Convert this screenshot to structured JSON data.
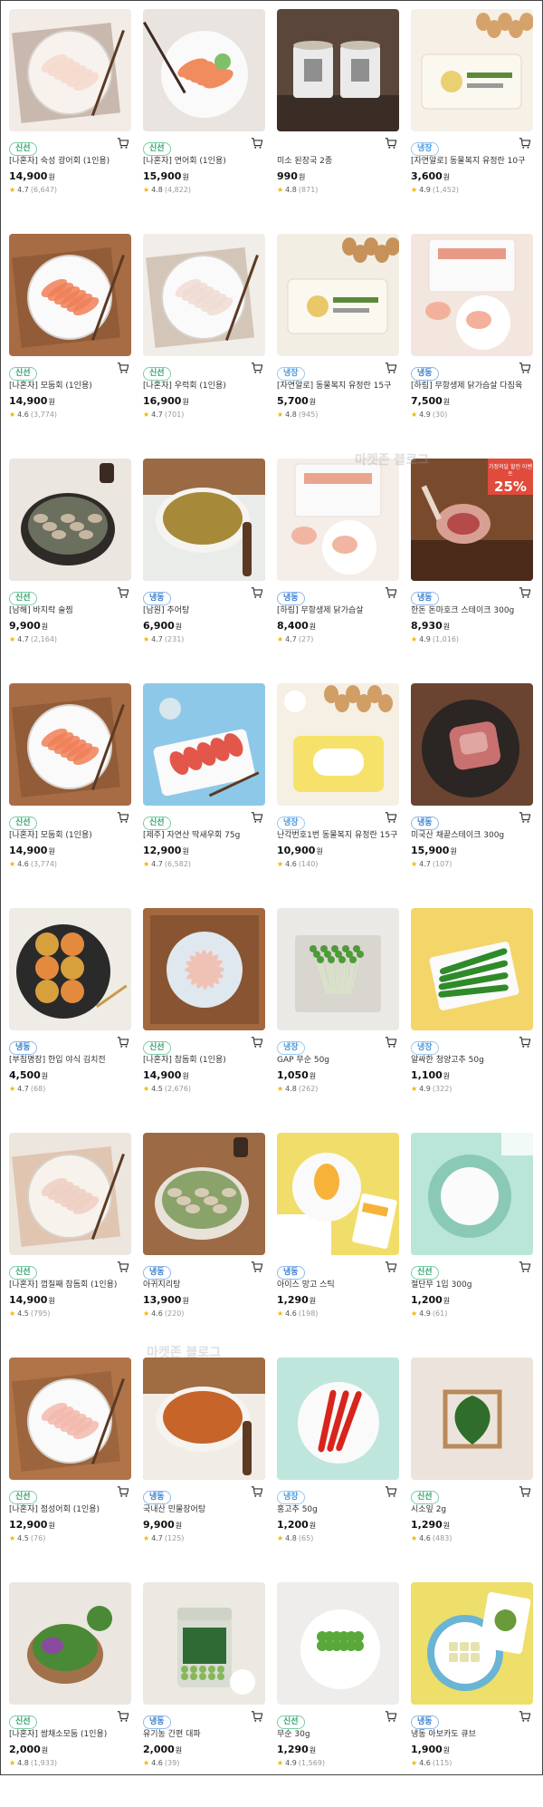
{
  "watermark": "마켓존 블로그",
  "products": [
    {
      "badge": "신선",
      "badge_type": "fresh",
      "name": "[나혼자] 숙성 광어회 (1인용)",
      "price": "14,900",
      "unit": "원",
      "score": "4.7",
      "count": "(6,647)",
      "img": "fish-plate",
      "colors": [
        "#f3ece6",
        "#7a5a44",
        "#f7f2ee",
        "#f5d9cc"
      ]
    },
    {
      "badge": "신선",
      "badge_type": "fresh",
      "name": "[나혼자] 연어회 (1인용)",
      "price": "15,900",
      "unit": "원",
      "score": "4.8",
      "count": "(4,822)",
      "img": "salmon-plate",
      "colors": [
        "#e9e4df",
        "#c89078",
        "#fafafa",
        "#f08c5e"
      ]
    },
    {
      "badge": "",
      "badge_type": "",
      "name": "미소 된장국 2종",
      "price": "990",
      "unit": "원",
      "score": "4.8",
      "count": "(871)",
      "img": "cups",
      "colors": [
        "#5a463a",
        "#3a2d26",
        "#eaeaea",
        "#c8c0b0"
      ]
    },
    {
      "badge": "냉장",
      "badge_type": "cold",
      "name": "[자연알로] 동물복지 유정란 10구",
      "price": "3,600",
      "unit": "원",
      "score": "4.9",
      "count": "(1,452)",
      "img": "eggs-box",
      "colors": [
        "#f6f0e6",
        "#d6a26b",
        "#fbf8f0",
        "#e9d070"
      ]
    },
    {
      "badge": "신선",
      "badge_type": "fresh",
      "name": "[나혼자] 모둠회 (1인용)",
      "price": "14,900",
      "unit": "원",
      "score": "4.6",
      "count": "(3,774)",
      "img": "fish-plate",
      "colors": [
        "#a86c44",
        "#6b3e24",
        "#fafafa",
        "#f07f57"
      ]
    },
    {
      "badge": "신선",
      "badge_type": "fresh",
      "name": "[나혼자] 우럭회 (1인용)",
      "price": "16,900",
      "unit": "원",
      "score": "4.7",
      "count": "(701)",
      "img": "fish-plate",
      "colors": [
        "#f1ede8",
        "#9b7b5d",
        "#fafafa",
        "#efdcd4"
      ]
    },
    {
      "badge": "냉장",
      "badge_type": "cold",
      "name": "[자연알로] 동물복지 유정란 15구",
      "price": "5,700",
      "unit": "원",
      "score": "4.8",
      "count": "(945)",
      "img": "eggs-box",
      "colors": [
        "#f3eee4",
        "#c6925a",
        "#fbf8f0",
        "#eac86a"
      ]
    },
    {
      "badge": "냉동",
      "badge_type": "frozen",
      "name": "[하림] 무항생제 닭가슴살 다짐육",
      "price": "7,500",
      "unit": "원",
      "score": "4.9",
      "count": "(30)",
      "img": "pack",
      "colors": [
        "#f2e6de",
        "#e89a86",
        "#fafafa",
        "#f3b19c"
      ]
    },
    {
      "badge": "신선",
      "badge_type": "fresh",
      "name": "[남해] 바지락 술찜",
      "price": "9,900",
      "unit": "원",
      "score": "4.7",
      "count": "(2,164)",
      "img": "pot",
      "colors": [
        "#ece6e0",
        "#2e2a28",
        "#6b6f5e",
        "#c5b7a2"
      ]
    },
    {
      "badge": "냉동",
      "badge_type": "frozen",
      "name": "[남원] 추어탕",
      "price": "6,900",
      "unit": "원",
      "score": "4.7",
      "count": "(231)",
      "img": "bowl",
      "colors": [
        "#9a6a44",
        "#5a3a22",
        "#e9ece8",
        "#a7893a"
      ]
    },
    {
      "badge": "냉동",
      "badge_type": "frozen",
      "name": "[하림] 무항생제 닭가슴살",
      "price": "8,400",
      "unit": "원",
      "score": "4.7",
      "count": "(27)",
      "img": "pack",
      "colors": [
        "#f5ede7",
        "#eaa58f",
        "#fafafa",
        "#f1b6a1"
      ]
    },
    {
      "badge": "냉동",
      "badge_type": "frozen",
      "name": "한돈 돈마호크 스테이크 300g",
      "price": "8,930",
      "unit": "원",
      "score": "4.9",
      "count": "(1,016)",
      "img": "steak-sale",
      "colors": [
        "#7a4a2c",
        "#4a2a18",
        "#d8a094",
        "#b44a4a"
      ]
    },
    {
      "badge": "신선",
      "badge_type": "fresh",
      "name": "[나혼자] 모둠회 (1인용)",
      "price": "14,900",
      "unit": "원",
      "score": "4.6",
      "count": "(3,774)",
      "img": "fish-plate",
      "colors": [
        "#a86c44",
        "#6b3e24",
        "#fafafa",
        "#f07f57"
      ]
    },
    {
      "badge": "신선",
      "badge_type": "fresh",
      "name": "[제주] 자연산 딱새우회 75g",
      "price": "12,900",
      "unit": "원",
      "score": "4.7",
      "count": "(6,582)",
      "img": "shrimp",
      "colors": [
        "#8ec8e8",
        "#5fa8d8",
        "#fafafa",
        "#e2574a"
      ]
    },
    {
      "badge": "냉장",
      "badge_type": "cold",
      "name": "난각번호1번 동물복지 유정란 15구",
      "price": "10,900",
      "unit": "원",
      "score": "4.6",
      "count": "(140)",
      "img": "eggs-yellow",
      "colors": [
        "#f5efe4",
        "#d19e66",
        "#f6e26a",
        "#ffffff"
      ]
    },
    {
      "badge": "냉동",
      "badge_type": "frozen",
      "name": "미국산 채끝스테이크 300g",
      "price": "15,900",
      "unit": "원",
      "score": "4.7",
      "count": "(107)",
      "img": "pan-steak",
      "colors": [
        "#6a4430",
        "#2b2523",
        "#c97070",
        "#e0a6a0"
      ]
    },
    {
      "badge": "냉동",
      "badge_type": "frozen",
      "name": "[부침명장] 한입 야식 김치전",
      "price": "4,500",
      "unit": "원",
      "score": "4.7",
      "count": "(68)",
      "img": "pancakes",
      "colors": [
        "#efebe5",
        "#2a2a2a",
        "#e48a3e",
        "#d8a03c"
      ]
    },
    {
      "badge": "신선",
      "badge_type": "fresh",
      "name": "[나혼자] 참돔회 (1인용)",
      "price": "14,900",
      "unit": "원",
      "score": "4.5",
      "count": "(2,676)",
      "img": "glass-plate",
      "colors": [
        "#a4683f",
        "#6c4024",
        "#dfe8ee",
        "#f0c2b6"
      ]
    },
    {
      "badge": "냉장",
      "badge_type": "cold",
      "name": "GAP 무순 50g",
      "price": "1,050",
      "unit": "원",
      "score": "4.8",
      "count": "(262)",
      "img": "sprouts",
      "colors": [
        "#ebe9e6",
        "#d9d5cf",
        "#4f9a3a",
        "#f4f4f2"
      ]
    },
    {
      "badge": "냉장",
      "badge_type": "cold",
      "name": "알싸한 청양고추 50g",
      "price": "1,100",
      "unit": "원",
      "score": "4.9",
      "count": "(322)",
      "img": "peppers",
      "colors": [
        "#f3d56a",
        "#f0cc55",
        "#fafafa",
        "#2f8a2a"
      ]
    },
    {
      "badge": "신선",
      "badge_type": "fresh",
      "name": "[나혼자] 껍질째 참돔회 (1인용)",
      "price": "14,900",
      "unit": "원",
      "score": "4.5",
      "count": "(795)",
      "img": "fish-plate",
      "colors": [
        "#ede6df",
        "#c9865b",
        "#f8f2ec",
        "#efcfc3"
      ]
    },
    {
      "badge": "냉동",
      "badge_type": "frozen",
      "name": "아귀지리탕",
      "price": "13,900",
      "unit": "원",
      "score": "4.6",
      "count": "(220)",
      "img": "pot",
      "colors": [
        "#9c6a44",
        "#e8e2d8",
        "#8aa36a",
        "#d8cbb6"
      ]
    },
    {
      "badge": "냉동",
      "badge_type": "frozen",
      "name": "아이스 망고 스틱",
      "price": "1,290",
      "unit": "원",
      "score": "4.6",
      "count": "(198)",
      "img": "mango",
      "colors": [
        "#f1dd6a",
        "#5a86c8",
        "#f7b23a",
        "#fafafa"
      ]
    },
    {
      "badge": "신선",
      "badge_type": "fresh",
      "name": "절단무 1입 300g",
      "price": "1,200",
      "unit": "원",
      "score": "4.9",
      "count": "(61)",
      "img": "radish",
      "colors": [
        "#b9e6d8",
        "#a2d9c8",
        "#8bc9b7",
        "#fbfbfb"
      ]
    },
    {
      "badge": "신선",
      "badge_type": "fresh",
      "name": "[나혼자] 점성어회 (1인용)",
      "price": "12,900",
      "unit": "원",
      "score": "4.5",
      "count": "(76)",
      "img": "fish-plate",
      "colors": [
        "#b07448",
        "#7a4a2a",
        "#fafafa",
        "#f2b8ad"
      ]
    },
    {
      "badge": "냉동",
      "badge_type": "frozen",
      "name": "국내산 민물장어탕",
      "price": "9,900",
      "unit": "원",
      "score": "4.7",
      "count": "(125)",
      "img": "bowl",
      "colors": [
        "#a06c42",
        "#5e3a22",
        "#f2ece6",
        "#c7642a"
      ]
    },
    {
      "badge": "냉장",
      "badge_type": "cold",
      "name": "홍고추 50g",
      "price": "1,200",
      "unit": "원",
      "score": "4.8",
      "count": "(65)",
      "img": "redpeppers",
      "colors": [
        "#bfe6dd",
        "#a9dbd0",
        "#fafafa",
        "#d8241c"
      ]
    },
    {
      "badge": "신선",
      "badge_type": "fresh",
      "name": "시소잎 2g",
      "price": "1,290",
      "unit": "원",
      "score": "4.6",
      "count": "(483)",
      "img": "shiso",
      "colors": [
        "#ece4dc",
        "#b98a5a",
        "#2f6e2a",
        "#f4efe8"
      ]
    },
    {
      "badge": "신선",
      "badge_type": "fresh",
      "name": "[나혼자] 쌈채소모둠 (1인용)",
      "price": "2,000",
      "unit": "원",
      "score": "4.8",
      "count": "(1,933)",
      "img": "greens-bowl",
      "colors": [
        "#ebe6e0",
        "#a0714a",
        "#4a8a36",
        "#8a4aa0"
      ]
    },
    {
      "badge": "냉동",
      "badge_type": "frozen",
      "name": "유기농 간편 대파",
      "price": "2,000",
      "unit": "원",
      "score": "4.6",
      "count": "(39)",
      "img": "jar",
      "colors": [
        "#ece8e2",
        "#2f6a34",
        "#86b85a",
        "#d9dcd2"
      ]
    },
    {
      "badge": "신선",
      "badge_type": "fresh",
      "name": "무순 30g",
      "price": "1,290",
      "unit": "원",
      "score": "4.9",
      "count": "(1,569)",
      "img": "sprouts-plate",
      "colors": [
        "#efedeb",
        "#dcd9d5",
        "#5aa83a",
        "#ffffff"
      ]
    },
    {
      "badge": "냉동",
      "badge_type": "frozen",
      "name": "냉동 아보카도 큐브",
      "price": "1,900",
      "unit": "원",
      "score": "4.6",
      "count": "(115)",
      "img": "avocado",
      "colors": [
        "#eede6a",
        "#6ab4d4",
        "#e6e2b0",
        "#6a9a3a"
      ]
    }
  ],
  "sale_badge": {
    "line1": "가정의달 할인 이벤트",
    "line2": "25%"
  }
}
